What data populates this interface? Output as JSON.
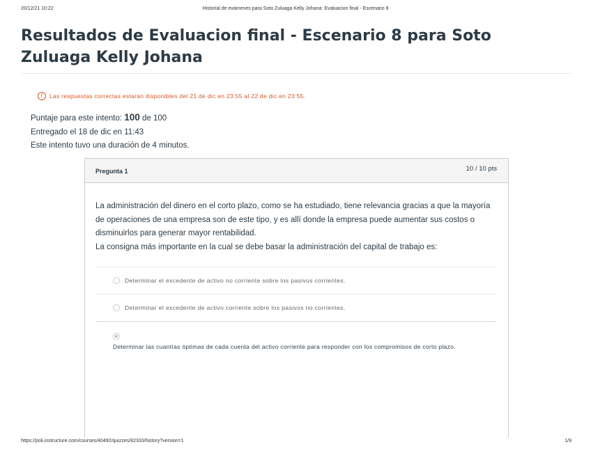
{
  "print_header": {
    "date": "20/12/21 10:22",
    "doc_title": "Historial de exámenes para Soto Zuluaga Kelly Johana: Evaluacion final - Escenario 8"
  },
  "page_title": "Resultados de Evaluacion final - Escenario 8 para Soto Zuluaga Kelly Johana",
  "notice": {
    "icon": "warning-icon",
    "text": "Las respuestas correctas estarán disponibles del 21 de dic en 23:55 al 22 de dic en 23:55.",
    "color": "#d9541e"
  },
  "summary": {
    "score_prefix": "Puntaje para este intento:",
    "score_value": "100",
    "score_suffix": "de 100",
    "submitted": "Entregado el 18 de dic en 11:43",
    "duration": "Este intento tuvo una duración de 4 minutos."
  },
  "question": {
    "title": "Pregunta 1",
    "points": "10 / 10 pts",
    "paragraph_1": "La administración del dinero en el corto plazo, como se ha estudiado, tiene relevancia gracias a que la mayoría de operaciones de una empresa son de este tipo, y es allí donde la empresa puede aumentar sus costos o disminuirlos para generar mayor rentabilidad.",
    "paragraph_2": "La consigna más importante en la cual se debe basar la administración del capital de trabajo es:",
    "answers": [
      {
        "label": "Determinar el excedente de activo no corriente sobre los pasivos corrientes.",
        "selected": false
      },
      {
        "label": "Determinar el excedente de activo corriente sobre los pasivos no corrientes.",
        "selected": false
      },
      {
        "label": "Determinar las cuantías óptimas de cada cuenta del activo corriente para responder con los compromisos de corto plazo.",
        "selected": true
      }
    ]
  },
  "print_footer": {
    "url": "https://poli.instructure.com/courses/40492/quizzes/82333/history?version=1",
    "page": "1/9"
  }
}
